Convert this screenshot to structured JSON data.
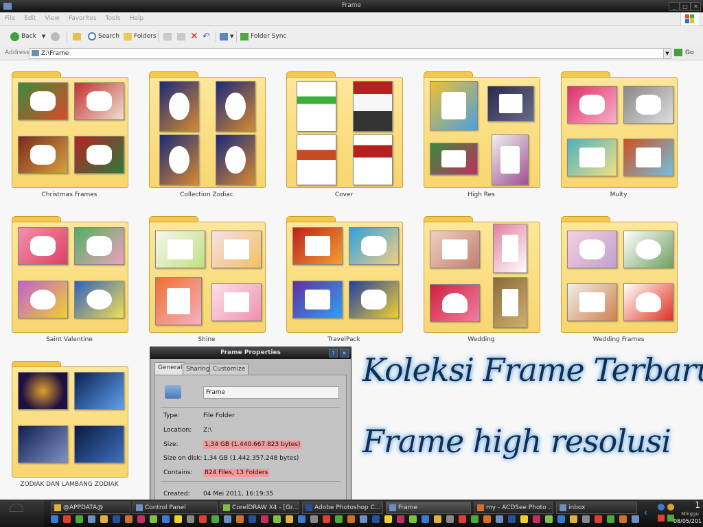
{
  "window": {
    "title": "Frame",
    "menu": [
      "File",
      "Edit",
      "View",
      "Favorites",
      "Tools",
      "Help"
    ],
    "toolbar": {
      "back": "Back",
      "search": "Search",
      "folders": "Folders",
      "folder_sync": "Folder Sync"
    },
    "address": {
      "label": "Address",
      "path": "Z:\\Frame",
      "go": "Go"
    }
  },
  "folders": [
    {
      "name": "Christmas Frames"
    },
    {
      "name": "Collection Zodiac"
    },
    {
      "name": "Cover"
    },
    {
      "name": "High Res"
    },
    {
      "name": "Multy"
    },
    {
      "name": "Saint Valentine"
    },
    {
      "name": "Shine"
    },
    {
      "name": "TravelPack"
    },
    {
      "name": "Wedding"
    },
    {
      "name": "Wedding Frames"
    },
    {
      "name": "ZODIAK DAN LAMBANG ZODIAK"
    }
  ],
  "dialog": {
    "title": "Frame Properties",
    "tabs": [
      "General",
      "Sharing",
      "Customize"
    ],
    "name_value": "Frame",
    "type_label": "Type:",
    "type_value": "File Folder",
    "location_label": "Location:",
    "location_value": "Z:\\",
    "size_label": "Size:",
    "size_value": "1,34 GB (1.440.667.823 bytes)",
    "size_on_disk_label": "Size on disk:",
    "size_on_disk_value": "1,34 GB (1.442.357.248 bytes)",
    "contains_label": "Contains:",
    "contains_value": "824 Files, 13 Folders",
    "created_label": "Created:",
    "created_value": "04 Mei 2011, 16:19:35"
  },
  "overlay": {
    "line1": "Koleksi Frame Terbaru",
    "line2": "Frame high resolusi"
  },
  "taskbar": {
    "tasks": [
      {
        "label": "@APPDATA@",
        "color": "#e0b040"
      },
      {
        "label": "Control Panel",
        "color": "#6a8fc0"
      },
      {
        "label": "CorelDRAW X4 - [Gr...",
        "color": "#7cc04a"
      },
      {
        "label": "Adobe Photoshop C...",
        "color": "#2a4f9a"
      },
      {
        "label": "Frame",
        "color": "#6a8fc0"
      },
      {
        "label": "my - ACDSee Photo ...",
        "color": "#d07030"
      },
      {
        "label": "inbox",
        "color": "#6a8fc0"
      }
    ],
    "clock_time": "1",
    "clock_day": "Minggu",
    "clock_date": "08/05/201"
  }
}
